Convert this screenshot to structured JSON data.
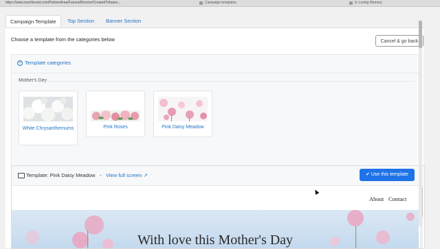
{
  "browser": {
    "url": "https://www.muchloved.com/PartnerArea/FuneralDirector/CreatedTributes...",
    "tabs": [
      {
        "label": "Campaign templates"
      },
      {
        "label": "In Loving Memory"
      }
    ]
  },
  "tabs": [
    {
      "label": "Campaign Template"
    },
    {
      "label": "Top Section"
    },
    {
      "label": "Banner Section"
    }
  ],
  "main": {
    "choose_text": "Choose a template from the categories below",
    "cancel_label": "Cancel & go back"
  },
  "categories": {
    "toggle_label": "Template categories",
    "toggle_symbol": "+",
    "group_name": "Mother's Day",
    "templates": [
      {
        "label": "White Chrysanthemums",
        "thumb": "white-flowers"
      },
      {
        "label": "Pink Roses",
        "thumb": "pink-roses"
      },
      {
        "label": "Pink Daisy Meadow",
        "thumb": "pink-daisies"
      }
    ]
  },
  "template_panel": {
    "title": "Template: Pink Daisy Meadow",
    "separator": "-",
    "fullscreen_label": "View full screen",
    "use_label": "Use this template",
    "accent": "#1f73e8"
  },
  "preview": {
    "nav": [
      "About",
      "Contact"
    ],
    "headline": "With love this Mother's Day"
  }
}
